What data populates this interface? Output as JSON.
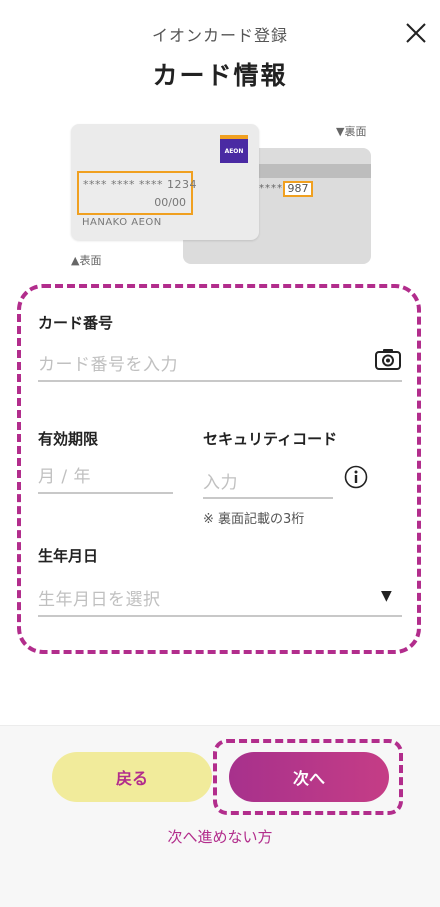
{
  "header": {
    "subtitle": "イオンカード登録",
    "title": "カード情報"
  },
  "card_illustration": {
    "back_label": "▼裏面",
    "front_label": "▲表面",
    "card_number_sample": "**** **** **** 1234",
    "expiry_sample": "00/00",
    "holder_name": "HANAKO AEON",
    "logo_text": "AEON",
    "cvv_mask": "****",
    "cvv_sample": "987"
  },
  "form": {
    "card_number": {
      "label": "カード番号",
      "placeholder": "カード番号を入力"
    },
    "expiry": {
      "label": "有効期限",
      "placeholder": "月 / 年"
    },
    "security_code": {
      "label": "セキュリティコード",
      "placeholder": "入力",
      "note": "※ 裏面記載の3桁"
    },
    "birthdate": {
      "label": "生年月日",
      "placeholder": "生年月日を選択"
    }
  },
  "icons": {
    "close": "close-icon",
    "camera": "camera-icon",
    "info": "info-icon",
    "dropdown": "caret-down-icon"
  },
  "actions": {
    "back_label": "戻る",
    "next_label": "次へ",
    "cannot_proceed_link": "次へ進めない方"
  },
  "colors": {
    "accent": "#b22d8c",
    "back_button": "#f1eb9b",
    "highlight": "#f0a020",
    "aeon_purple": "#4a2aa3"
  }
}
